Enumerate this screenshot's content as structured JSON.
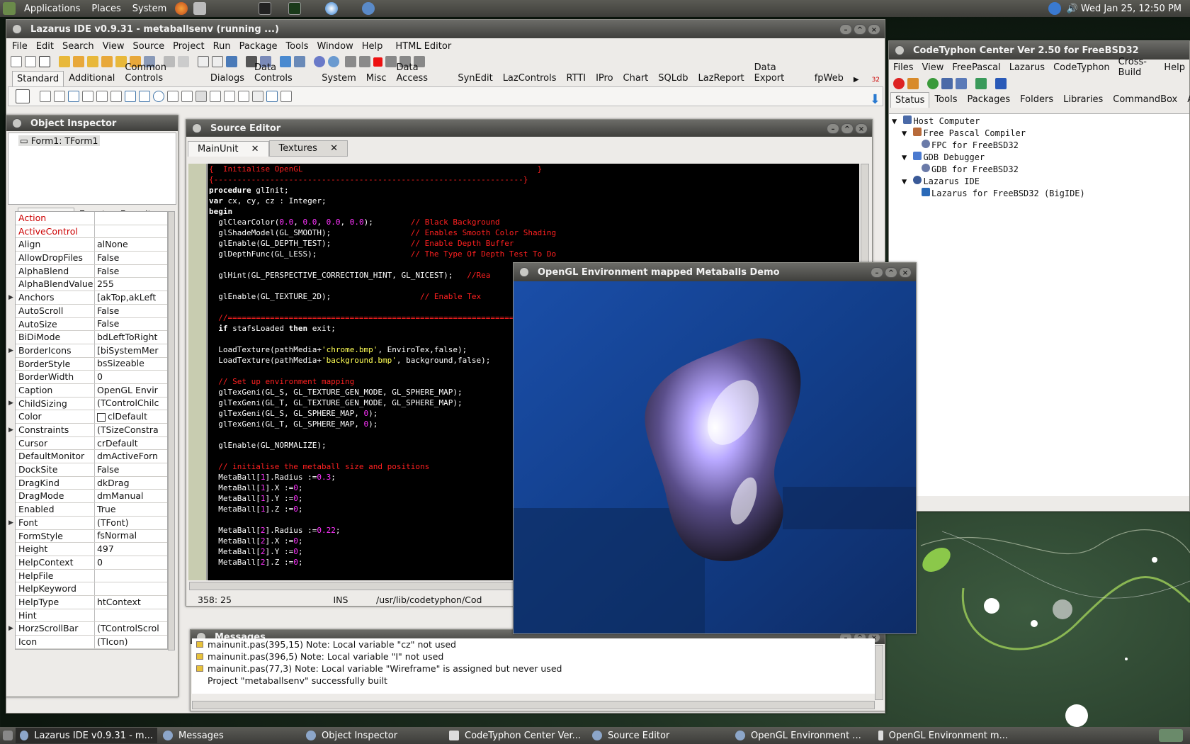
{
  "topbar": {
    "menus": [
      "Applications",
      "Places",
      "System"
    ],
    "clock": "Wed Jan 25, 12:50 PM"
  },
  "ide": {
    "title": "Lazarus IDE v0.9.31 - metaballsenv (running ...)",
    "menus": [
      "File",
      "Edit",
      "Search",
      "View",
      "Source",
      "Project",
      "Run",
      "Package",
      "Tools",
      "Window",
      "Help",
      "HTML Editor"
    ],
    "palette_tabs": [
      "Standard",
      "Additional",
      "Common Controls",
      "Dialogs",
      "Data Controls",
      "System",
      "Misc",
      "Data Access",
      "SynEdit",
      "LazControls",
      "RTTI",
      "IPro",
      "Chart",
      "SQLdb",
      "LazReport",
      "Data Export",
      "fpWeb"
    ],
    "palette_count": "32"
  },
  "inspector": {
    "title": "Object Inspector",
    "tree_item": "Form1: TForm1",
    "tabs": [
      "Properties",
      "Events",
      "Favorites"
    ],
    "rows": [
      {
        "n": "Action",
        "v": "",
        "red": true
      },
      {
        "n": "ActiveControl",
        "v": "",
        "red": true
      },
      {
        "n": "Align",
        "v": "alNone"
      },
      {
        "n": "AllowDropFiles",
        "v": "False"
      },
      {
        "n": "AlphaBlend",
        "v": "False"
      },
      {
        "n": "AlphaBlendValue",
        "v": "255"
      },
      {
        "n": "Anchors",
        "v": "[akTop,akLeft",
        "ex": true
      },
      {
        "n": "AutoScroll",
        "v": "False"
      },
      {
        "n": "AutoSize",
        "v": "False"
      },
      {
        "n": "BiDiMode",
        "v": "bdLeftToRight"
      },
      {
        "n": "BorderIcons",
        "v": "[biSystemMer",
        "ex": true
      },
      {
        "n": "BorderStyle",
        "v": "bsSizeable"
      },
      {
        "n": "BorderWidth",
        "v": "0"
      },
      {
        "n": "Caption",
        "v": "OpenGL Envir"
      },
      {
        "n": "ChildSizing",
        "v": "(TControlChilc",
        "ex": true
      },
      {
        "n": "Color",
        "v": "clDefault",
        "sw": true
      },
      {
        "n": "Constraints",
        "v": "(TSizeConstra",
        "ex": true
      },
      {
        "n": "Cursor",
        "v": "crDefault"
      },
      {
        "n": "DefaultMonitor",
        "v": "dmActiveForn"
      },
      {
        "n": "DockSite",
        "v": "False"
      },
      {
        "n": "DragKind",
        "v": "dkDrag"
      },
      {
        "n": "DragMode",
        "v": "dmManual"
      },
      {
        "n": "Enabled",
        "v": "True"
      },
      {
        "n": "Font",
        "v": "(TFont)",
        "ex": true
      },
      {
        "n": "FormStyle",
        "v": "fsNormal"
      },
      {
        "n": "Height",
        "v": "497"
      },
      {
        "n": "HelpContext",
        "v": "0"
      },
      {
        "n": "HelpFile",
        "v": ""
      },
      {
        "n": "HelpKeyword",
        "v": ""
      },
      {
        "n": "HelpType",
        "v": "htContext"
      },
      {
        "n": "Hint",
        "v": ""
      },
      {
        "n": "HorzScrollBar",
        "v": "(TControlScrol",
        "ex": true
      },
      {
        "n": "Icon",
        "v": "(TIcon)"
      }
    ]
  },
  "source": {
    "title": "Source Editor",
    "tabs": [
      "MainUnit",
      "Textures"
    ],
    "status": {
      "pos": "358: 25",
      "mode": "INS",
      "path": "/usr/lib/codetyphon/Cod"
    },
    "lines": [
      [
        [
          "r",
          "{  Initialise OpenGL                                                  }"
        ]
      ],
      [
        [
          "r",
          "{------------------------------------------------------------------}"
        ]
      ],
      [
        [
          "k",
          "procedure"
        ],
        [
          "w",
          " glInit;"
        ]
      ],
      [
        [
          "k",
          "var"
        ],
        [
          "w",
          " cx, cy, cz : Integer;"
        ]
      ],
      [
        [
          "k",
          "begin"
        ]
      ],
      [
        [
          "w",
          "  glClearColor("
        ],
        [
          "m",
          "0.0"
        ],
        [
          "w",
          ", "
        ],
        [
          "m",
          "0.0"
        ],
        [
          "w",
          ", "
        ],
        [
          "m",
          "0.0"
        ],
        [
          "w",
          ", "
        ],
        [
          "m",
          "0.0"
        ],
        [
          "w",
          ");        "
        ],
        [
          "r",
          "// Black Background"
        ]
      ],
      [
        [
          "w",
          "  glShadeModel(GL_SMOOTH);                 "
        ],
        [
          "r",
          "// Enables Smooth Color Shading"
        ]
      ],
      [
        [
          "w",
          "  glEnable(GL_DEPTH_TEST);                 "
        ],
        [
          "r",
          "// Enable Depth Buffer"
        ]
      ],
      [
        [
          "w",
          "  glDepthFunc(GL_LESS);                    "
        ],
        [
          "r",
          "// The Type Of Depth Test To Do"
        ]
      ],
      [
        [
          "w",
          ""
        ]
      ],
      [
        [
          "w",
          "  glHint(GL_PERSPECTIVE_CORRECTION_HINT, GL_NICEST);   "
        ],
        [
          "r",
          "//Rea"
        ]
      ],
      [
        [
          "w",
          ""
        ]
      ],
      [
        [
          "w",
          "  glEnable(GL_TEXTURE_2D);                   "
        ],
        [
          "r",
          "// Enable Tex"
        ]
      ],
      [
        [
          "w",
          ""
        ]
      ],
      [
        [
          "r",
          "  //=============================================================="
        ]
      ],
      [
        [
          "w",
          "  "
        ],
        [
          "k",
          "if"
        ],
        [
          "w",
          " stafsLoaded "
        ],
        [
          "k",
          "then"
        ],
        [
          "w",
          " exit;"
        ]
      ],
      [
        [
          "w",
          ""
        ]
      ],
      [
        [
          "w",
          "  LoadTexture(pathMedia+"
        ],
        [
          "y",
          "'chrome.bmp'"
        ],
        [
          "w",
          ", EnviroTex,false);"
        ]
      ],
      [
        [
          "w",
          "  LoadTexture(pathMedia+"
        ],
        [
          "y",
          "'background.bmp'"
        ],
        [
          "w",
          ", background,false);"
        ]
      ],
      [
        [
          "w",
          ""
        ]
      ],
      [
        [
          "r",
          "  // Set up environment mapping"
        ]
      ],
      [
        [
          "w",
          "  glTexGeni(GL_S, GL_TEXTURE_GEN_MODE, GL_SPHERE_MAP);"
        ]
      ],
      [
        [
          "w",
          "  glTexGeni(GL_T, GL_TEXTURE_GEN_MODE, GL_SPHERE_MAP);"
        ]
      ],
      [
        [
          "w",
          "  glTexGeni(GL_S, GL_SPHERE_MAP, "
        ],
        [
          "m",
          "0"
        ],
        [
          "w",
          ");"
        ]
      ],
      [
        [
          "w",
          "  glTexGeni(GL_T, GL_SPHERE_MAP, "
        ],
        [
          "m",
          "0"
        ],
        [
          "w",
          ");"
        ]
      ],
      [
        [
          "w",
          ""
        ]
      ],
      [
        [
          "w",
          "  glEnable(GL_NORMALIZE);"
        ]
      ],
      [
        [
          "w",
          ""
        ]
      ],
      [
        [
          "r",
          "  // initialise the metaball size and positions"
        ]
      ],
      [
        [
          "w",
          "  MetaBall["
        ],
        [
          "m",
          "1"
        ],
        [
          "w",
          "].Radius :="
        ],
        [
          "m",
          "0.3"
        ],
        [
          "w",
          ";"
        ]
      ],
      [
        [
          "w",
          "  MetaBall["
        ],
        [
          "m",
          "1"
        ],
        [
          "w",
          "].X :="
        ],
        [
          "m",
          "0"
        ],
        [
          "w",
          ";"
        ]
      ],
      [
        [
          "w",
          "  MetaBall["
        ],
        [
          "m",
          "1"
        ],
        [
          "w",
          "].Y :="
        ],
        [
          "m",
          "0"
        ],
        [
          "w",
          ";"
        ]
      ],
      [
        [
          "w",
          "  MetaBall["
        ],
        [
          "m",
          "1"
        ],
        [
          "w",
          "].Z :="
        ],
        [
          "m",
          "0"
        ],
        [
          "w",
          ";"
        ]
      ],
      [
        [
          "w",
          ""
        ]
      ],
      [
        [
          "w",
          "  MetaBall["
        ],
        [
          "m",
          "2"
        ],
        [
          "w",
          "].Radius :="
        ],
        [
          "m",
          "0.22"
        ],
        [
          "w",
          ";"
        ]
      ],
      [
        [
          "w",
          "  MetaBall["
        ],
        [
          "m",
          "2"
        ],
        [
          "w",
          "].X :="
        ],
        [
          "m",
          "0"
        ],
        [
          "w",
          ";"
        ]
      ],
      [
        [
          "w",
          "  MetaBall["
        ],
        [
          "m",
          "2"
        ],
        [
          "w",
          "].Y :="
        ],
        [
          "m",
          "0"
        ],
        [
          "w",
          ";"
        ]
      ],
      [
        [
          "w",
          "  MetaBall["
        ],
        [
          "m",
          "2"
        ],
        [
          "w",
          "].Z :="
        ],
        [
          "m",
          "0"
        ],
        [
          "w",
          ";"
        ]
      ]
    ]
  },
  "messages": {
    "title": "Messages",
    "lines": [
      "mainunit.pas(395,15) Note: Local variable \"cz\" not used",
      "mainunit.pas(396,5) Note: Local variable \"I\" not used",
      "mainunit.pas(77,3) Note: Local variable \"Wireframe\" is assigned but never used",
      "Project \"metaballsenv\" successfully built"
    ]
  },
  "opengl": {
    "title": "OpenGL Environment mapped Metaballs Demo"
  },
  "codetyphon": {
    "title": "CodeTyphon Center Ver 2.50 for FreeBSD32",
    "menus": [
      "Files",
      "View",
      "FreePascal",
      "Lazarus",
      "CodeTyphon",
      "Cross-Build",
      "Help"
    ],
    "tabs": [
      "Status",
      "Tools",
      "Packages",
      "Folders",
      "Libraries",
      "CommandBox",
      "Ab"
    ],
    "tree": [
      {
        "level": 0,
        "label": "Host Computer"
      },
      {
        "level": 1,
        "label": "Free Pascal Compiler"
      },
      {
        "level": 2,
        "label": "FPC for FreeBSD32"
      },
      {
        "level": 1,
        "label": "GDB Debugger"
      },
      {
        "level": 2,
        "label": "GDB for FreeBSD32"
      },
      {
        "level": 1,
        "label": "Lazarus IDE"
      },
      {
        "level": 2,
        "label": "Lazarus for FreeBSD32 (BigIDE)"
      }
    ]
  },
  "taskbar": [
    "Lazarus IDE v0.9.31 - m...",
    "Messages",
    "Object Inspector",
    "CodeTyphon Center Ver...",
    "Source Editor",
    "OpenGL Environment ...",
    "OpenGL Environment m..."
  ],
  "colors": {
    "code_red": "#ff2020",
    "code_key": "#ffffff",
    "code_num": "#ff33ff",
    "code_str": "#ffff55",
    "title_dark": "#3f3f3c"
  }
}
